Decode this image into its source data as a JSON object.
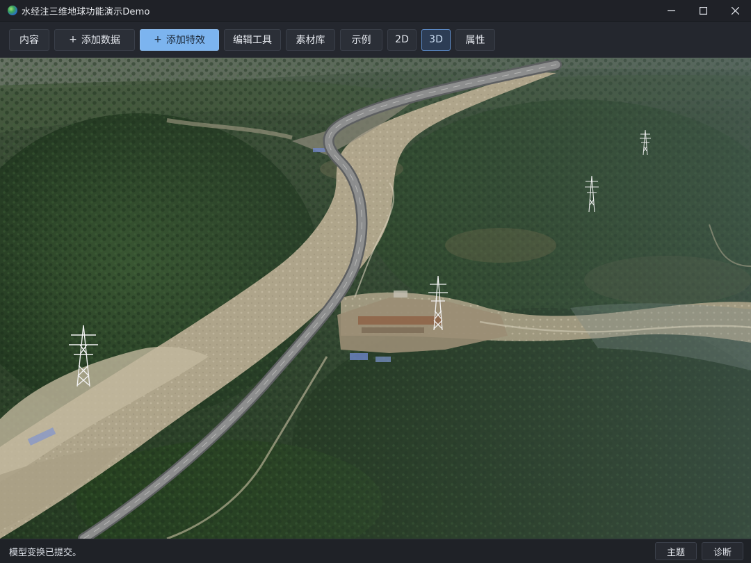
{
  "window": {
    "title": "水经注三维地球功能演示Demo",
    "app_icon": "globe-icon",
    "controls": [
      "minimize-icon",
      "maximize-icon",
      "close-icon"
    ]
  },
  "toolbar": {
    "buttons": [
      {
        "label": "内容",
        "icon": null,
        "state": "normal"
      },
      {
        "label": "添加数据",
        "icon": "plus-icon",
        "state": "normal"
      },
      {
        "label": "添加特效",
        "icon": "plus-icon",
        "state": "primary"
      },
      {
        "label": "编辑工具",
        "icon": null,
        "state": "normal"
      },
      {
        "label": "素材库",
        "icon": null,
        "state": "normal"
      },
      {
        "label": "示例",
        "icon": null,
        "state": "normal"
      },
      {
        "label": "2D",
        "icon": null,
        "state": "normal"
      },
      {
        "label": "3D",
        "icon": null,
        "state": "active"
      },
      {
        "label": "属性",
        "icon": null,
        "state": "normal"
      }
    ],
    "plus_glyph": "+"
  },
  "viewport": {
    "content": "3d-satellite-terrain",
    "objects": [
      "power-tower-icon",
      "power-tower-icon",
      "power-tower-icon",
      "power-tower-icon"
    ]
  },
  "statusbar": {
    "message": "模型变换已提交。",
    "theme_label": "主题",
    "diagnose_label": "诊断"
  },
  "colors": {
    "primary_button": "#7cb4ef",
    "active_button_border": "#5d8cc9",
    "forest": "#2f4a2a",
    "riverbed": "#b8ad92",
    "road": "#6e6f70"
  }
}
